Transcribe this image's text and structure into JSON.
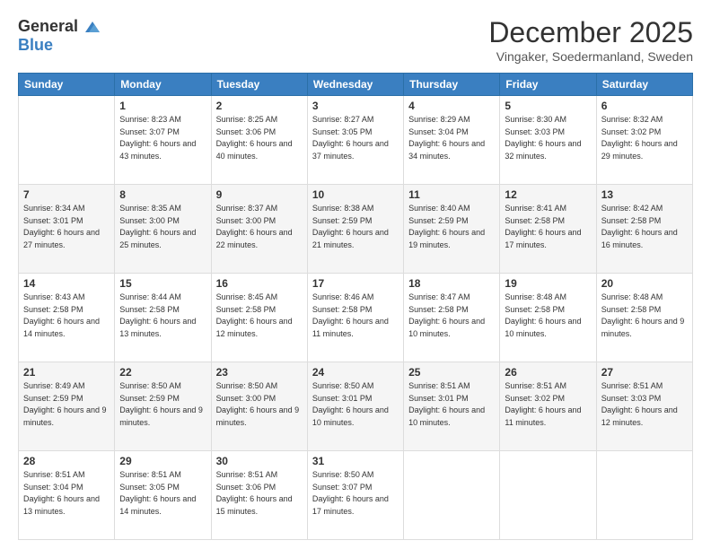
{
  "header": {
    "logo_general": "General",
    "logo_blue": "Blue",
    "title": "December 2025",
    "subtitle": "Vingaker, Soedermanland, Sweden"
  },
  "calendar": {
    "days_of_week": [
      "Sunday",
      "Monday",
      "Tuesday",
      "Wednesday",
      "Thursday",
      "Friday",
      "Saturday"
    ],
    "weeks": [
      [
        {
          "day": "",
          "sunrise": "",
          "sunset": "",
          "daylight": ""
        },
        {
          "day": "1",
          "sunrise": "Sunrise: 8:23 AM",
          "sunset": "Sunset: 3:07 PM",
          "daylight": "Daylight: 6 hours and 43 minutes."
        },
        {
          "day": "2",
          "sunrise": "Sunrise: 8:25 AM",
          "sunset": "Sunset: 3:06 PM",
          "daylight": "Daylight: 6 hours and 40 minutes."
        },
        {
          "day": "3",
          "sunrise": "Sunrise: 8:27 AM",
          "sunset": "Sunset: 3:05 PM",
          "daylight": "Daylight: 6 hours and 37 minutes."
        },
        {
          "day": "4",
          "sunrise": "Sunrise: 8:29 AM",
          "sunset": "Sunset: 3:04 PM",
          "daylight": "Daylight: 6 hours and 34 minutes."
        },
        {
          "day": "5",
          "sunrise": "Sunrise: 8:30 AM",
          "sunset": "Sunset: 3:03 PM",
          "daylight": "Daylight: 6 hours and 32 minutes."
        },
        {
          "day": "6",
          "sunrise": "Sunrise: 8:32 AM",
          "sunset": "Sunset: 3:02 PM",
          "daylight": "Daylight: 6 hours and 29 minutes."
        }
      ],
      [
        {
          "day": "7",
          "sunrise": "Sunrise: 8:34 AM",
          "sunset": "Sunset: 3:01 PM",
          "daylight": "Daylight: 6 hours and 27 minutes."
        },
        {
          "day": "8",
          "sunrise": "Sunrise: 8:35 AM",
          "sunset": "Sunset: 3:00 PM",
          "daylight": "Daylight: 6 hours and 25 minutes."
        },
        {
          "day": "9",
          "sunrise": "Sunrise: 8:37 AM",
          "sunset": "Sunset: 3:00 PM",
          "daylight": "Daylight: 6 hours and 22 minutes."
        },
        {
          "day": "10",
          "sunrise": "Sunrise: 8:38 AM",
          "sunset": "Sunset: 2:59 PM",
          "daylight": "Daylight: 6 hours and 21 minutes."
        },
        {
          "day": "11",
          "sunrise": "Sunrise: 8:40 AM",
          "sunset": "Sunset: 2:59 PM",
          "daylight": "Daylight: 6 hours and 19 minutes."
        },
        {
          "day": "12",
          "sunrise": "Sunrise: 8:41 AM",
          "sunset": "Sunset: 2:58 PM",
          "daylight": "Daylight: 6 hours and 17 minutes."
        },
        {
          "day": "13",
          "sunrise": "Sunrise: 8:42 AM",
          "sunset": "Sunset: 2:58 PM",
          "daylight": "Daylight: 6 hours and 16 minutes."
        }
      ],
      [
        {
          "day": "14",
          "sunrise": "Sunrise: 8:43 AM",
          "sunset": "Sunset: 2:58 PM",
          "daylight": "Daylight: 6 hours and 14 minutes."
        },
        {
          "day": "15",
          "sunrise": "Sunrise: 8:44 AM",
          "sunset": "Sunset: 2:58 PM",
          "daylight": "Daylight: 6 hours and 13 minutes."
        },
        {
          "day": "16",
          "sunrise": "Sunrise: 8:45 AM",
          "sunset": "Sunset: 2:58 PM",
          "daylight": "Daylight: 6 hours and 12 minutes."
        },
        {
          "day": "17",
          "sunrise": "Sunrise: 8:46 AM",
          "sunset": "Sunset: 2:58 PM",
          "daylight": "Daylight: 6 hours and 11 minutes."
        },
        {
          "day": "18",
          "sunrise": "Sunrise: 8:47 AM",
          "sunset": "Sunset: 2:58 PM",
          "daylight": "Daylight: 6 hours and 10 minutes."
        },
        {
          "day": "19",
          "sunrise": "Sunrise: 8:48 AM",
          "sunset": "Sunset: 2:58 PM",
          "daylight": "Daylight: 6 hours and 10 minutes."
        },
        {
          "day": "20",
          "sunrise": "Sunrise: 8:48 AM",
          "sunset": "Sunset: 2:58 PM",
          "daylight": "Daylight: 6 hours and 9 minutes."
        }
      ],
      [
        {
          "day": "21",
          "sunrise": "Sunrise: 8:49 AM",
          "sunset": "Sunset: 2:59 PM",
          "daylight": "Daylight: 6 hours and 9 minutes."
        },
        {
          "day": "22",
          "sunrise": "Sunrise: 8:50 AM",
          "sunset": "Sunset: 2:59 PM",
          "daylight": "Daylight: 6 hours and 9 minutes."
        },
        {
          "day": "23",
          "sunrise": "Sunrise: 8:50 AM",
          "sunset": "Sunset: 3:00 PM",
          "daylight": "Daylight: 6 hours and 9 minutes."
        },
        {
          "day": "24",
          "sunrise": "Sunrise: 8:50 AM",
          "sunset": "Sunset: 3:01 PM",
          "daylight": "Daylight: 6 hours and 10 minutes."
        },
        {
          "day": "25",
          "sunrise": "Sunrise: 8:51 AM",
          "sunset": "Sunset: 3:01 PM",
          "daylight": "Daylight: 6 hours and 10 minutes."
        },
        {
          "day": "26",
          "sunrise": "Sunrise: 8:51 AM",
          "sunset": "Sunset: 3:02 PM",
          "daylight": "Daylight: 6 hours and 11 minutes."
        },
        {
          "day": "27",
          "sunrise": "Sunrise: 8:51 AM",
          "sunset": "Sunset: 3:03 PM",
          "daylight": "Daylight: 6 hours and 12 minutes."
        }
      ],
      [
        {
          "day": "28",
          "sunrise": "Sunrise: 8:51 AM",
          "sunset": "Sunset: 3:04 PM",
          "daylight": "Daylight: 6 hours and 13 minutes."
        },
        {
          "day": "29",
          "sunrise": "Sunrise: 8:51 AM",
          "sunset": "Sunset: 3:05 PM",
          "daylight": "Daylight: 6 hours and 14 minutes."
        },
        {
          "day": "30",
          "sunrise": "Sunrise: 8:51 AM",
          "sunset": "Sunset: 3:06 PM",
          "daylight": "Daylight: 6 hours and 15 minutes."
        },
        {
          "day": "31",
          "sunrise": "Sunrise: 8:50 AM",
          "sunset": "Sunset: 3:07 PM",
          "daylight": "Daylight: 6 hours and 17 minutes."
        },
        {
          "day": "",
          "sunrise": "",
          "sunset": "",
          "daylight": ""
        },
        {
          "day": "",
          "sunrise": "",
          "sunset": "",
          "daylight": ""
        },
        {
          "day": "",
          "sunrise": "",
          "sunset": "",
          "daylight": ""
        }
      ]
    ]
  }
}
